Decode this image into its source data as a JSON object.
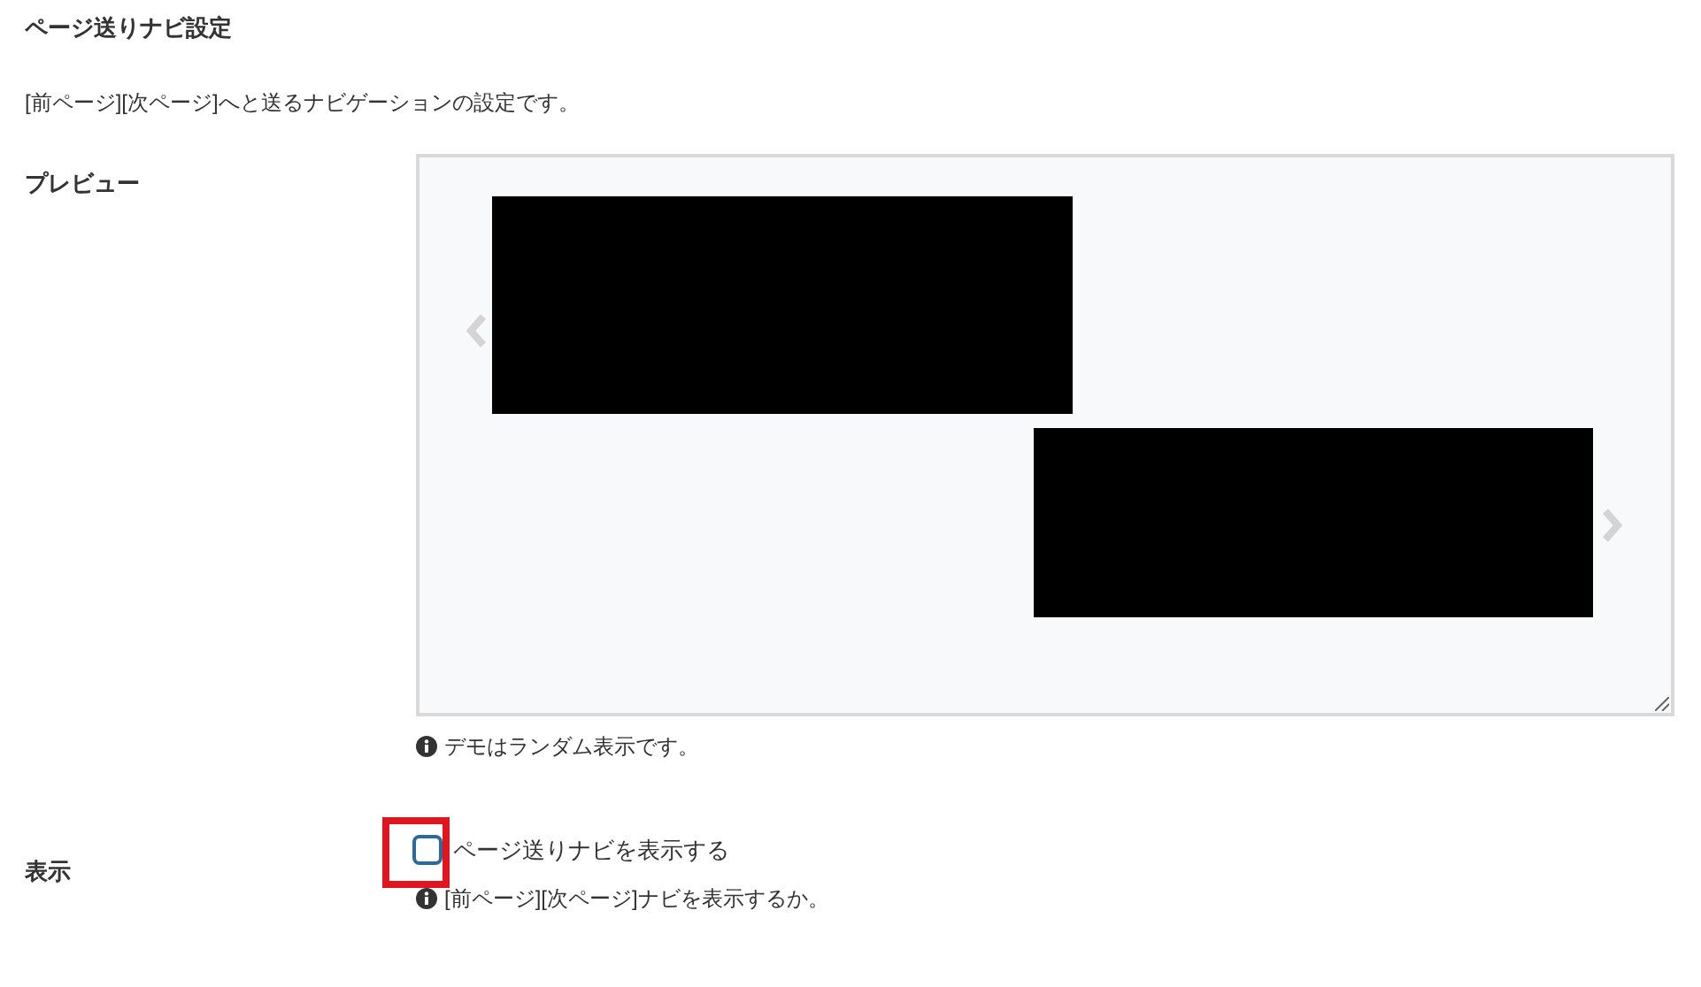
{
  "title": "ページ送りナビ設定",
  "description": "[前ページ][次ページ]へと送るナビゲーションの設定です。",
  "preview": {
    "label": "プレビュー",
    "note": "デモはランダム表示です。"
  },
  "display": {
    "label": "表示",
    "checkbox": {
      "label": "ページ送りナビを表示する",
      "checked": false
    },
    "help": "[前ページ][次ページ]ナビを表示するか。",
    "highlighted": true
  }
}
